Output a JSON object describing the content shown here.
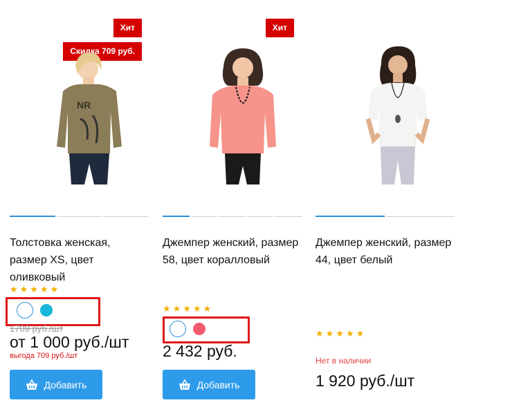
{
  "products": [
    {
      "badges": {
        "hit": "Хит",
        "discount": "Скидка 709 руб."
      },
      "title": "Толстовка женская, размер XS, цвет оливковый",
      "stars": "★★★★★",
      "swatch_colors": [
        "#ffffff",
        "#18b6d8"
      ],
      "old_price": "1709 руб./шт",
      "price": "от 1 000 руб./шт",
      "savings": "выгода 709 руб./шт",
      "button_label": "Добавить",
      "image_icon": "sweater-model-image"
    },
    {
      "badges": {
        "hit": "Хит"
      },
      "title": "Джемпер женский, размер 58, цвет коралловый",
      "stars": "★★★★★",
      "swatch_colors": [
        "#ffffff",
        "#f25c6f"
      ],
      "price": "2 432 руб.",
      "button_label": "Добавить",
      "image_icon": "coral-jumper-model-image"
    },
    {
      "title": "Джемпер женский, размер 44, цвет белый",
      "stars": "★★★★★",
      "stock_status": "Нет в наличии",
      "price": "1 920 руб./шт",
      "image_icon": "white-jumper-model-image"
    }
  ],
  "colors": {
    "badge": "#d50000",
    "accent": "#2e9bea",
    "star": "#f2b100",
    "highlight": "#e01818"
  }
}
